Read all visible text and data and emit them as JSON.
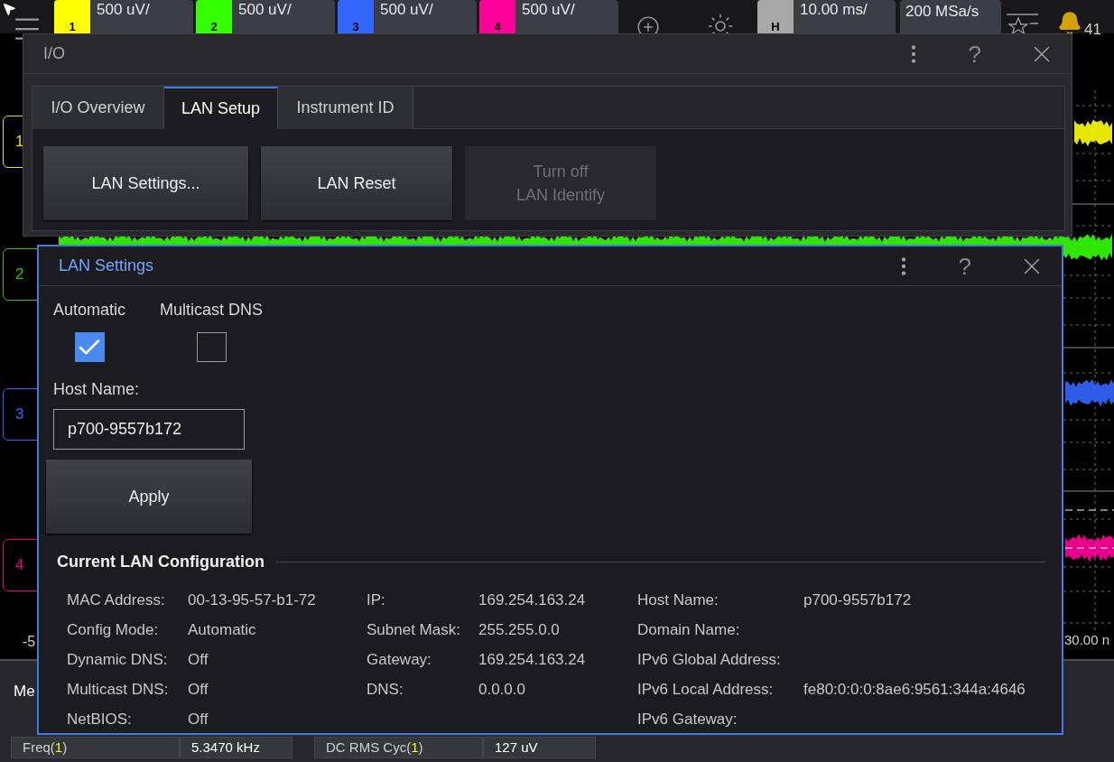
{
  "top_bar": {
    "channels": [
      {
        "label": "1",
        "scale": "500 uV/",
        "color": "#ffff00"
      },
      {
        "label": "2",
        "scale": "500 uV/",
        "color": "#33ff00"
      },
      {
        "label": "3",
        "scale": "500 uV/",
        "color": "#3366ff"
      },
      {
        "label": "4",
        "scale": "500 uV/",
        "color": "#ff0099"
      }
    ],
    "timebase": {
      "label": "H",
      "scale": "10.00 ms/"
    },
    "sample_rate": "200 MSa/s",
    "notifications": "41"
  },
  "scope": {
    "channel_markers": [
      {
        "label": "1",
        "color": "#e6e600"
      },
      {
        "label": "2",
        "color": "#22cc00"
      },
      {
        "label": "3",
        "color": "#3366ff"
      },
      {
        "label": "4",
        "color": "#e6007a"
      }
    ],
    "left_axis_label": "-5",
    "right_axis_label": "30.00 n"
  },
  "measurements": {
    "tab": "Me",
    "rows": [
      {
        "prefix": "Freq(",
        "channel": "1",
        "suffix": ")",
        "value": "5.3470 kHz"
      },
      {
        "prefix": "DC RMS Cyc(",
        "channel": "1",
        "suffix": ")",
        "value": "127 uV"
      }
    ]
  },
  "io_dialog": {
    "title": "I/O",
    "help": "?",
    "tabs": [
      {
        "label": "I/O Overview",
        "selected": false
      },
      {
        "label": "LAN Setup",
        "selected": true
      },
      {
        "label": "Instrument ID",
        "selected": false
      }
    ],
    "buttons": [
      {
        "label": "LAN Settings...",
        "disabled": false
      },
      {
        "label": "LAN Reset",
        "disabled": false
      },
      {
        "label": "Turn off\nLAN Identify",
        "disabled": true
      }
    ]
  },
  "lan_dialog": {
    "title": "LAN Settings",
    "help": "?",
    "checkboxes": [
      {
        "label": "Automatic",
        "checked": true
      },
      {
        "label": "Multicast DNS",
        "checked": false
      }
    ],
    "host_name": {
      "label": "Host Name:",
      "value": "p700-9557b172"
    },
    "apply": "Apply",
    "config": {
      "title": "Current LAN Configuration",
      "columns": [
        [
          {
            "label": "MAC Address:",
            "value": "00-13-95-57-b1-72"
          },
          {
            "label": "Config Mode:",
            "value": "Automatic"
          },
          {
            "label": "Dynamic DNS:",
            "value": "Off"
          },
          {
            "label": "Multicast DNS:",
            "value": "Off"
          },
          {
            "label": "NetBIOS:",
            "value": "Off"
          }
        ],
        [
          {
            "label": "IP:",
            "value": "169.254.163.24"
          },
          {
            "label": "Subnet Mask:",
            "value": "255.255.0.0"
          },
          {
            "label": "Gateway:",
            "value": "169.254.163.24"
          },
          {
            "label": "DNS:",
            "value": "0.0.0.0"
          }
        ],
        [
          {
            "label": "Host Name:",
            "value": "p700-9557b172"
          },
          {
            "label": "Domain Name:"
          },
          {
            "label": "IPv6 Global Address:"
          },
          {
            "label": "IPv6 Local Address:",
            "value": "fe80:0:0:0:8ae6:9561:344a:4646"
          },
          {
            "label": "IPv6 Gateway:"
          }
        ]
      ]
    }
  }
}
